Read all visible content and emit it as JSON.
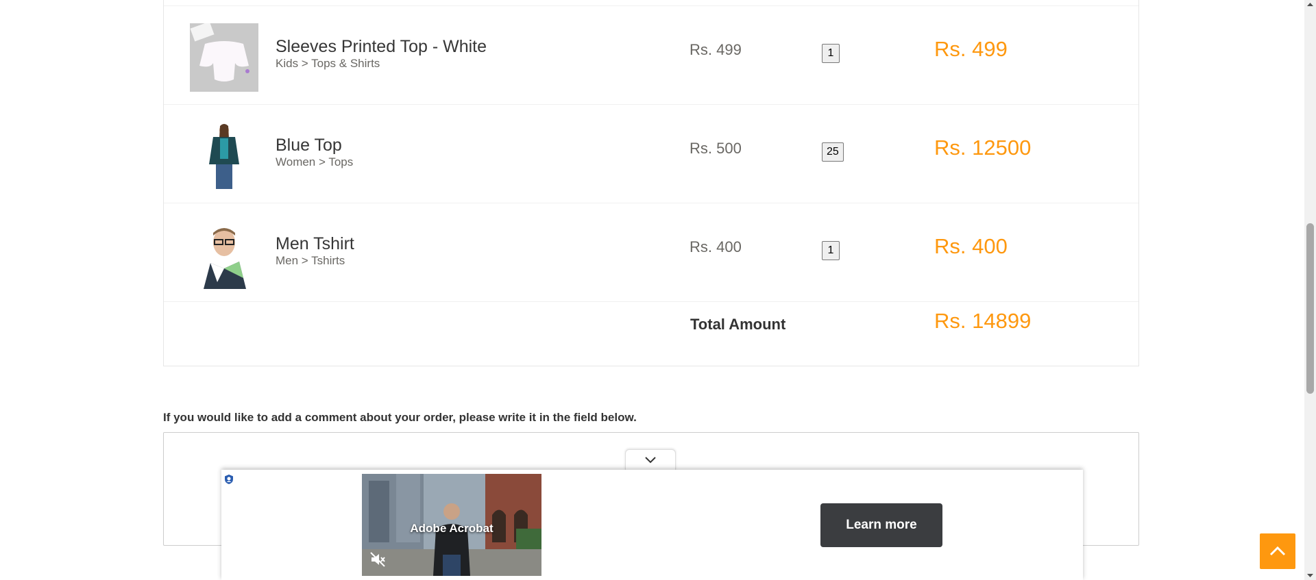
{
  "cart": {
    "items": [
      {
        "name": "Sleeves Printed Top - White",
        "category": "Kids > Tops & Shirts",
        "price": "Rs. 499",
        "quantity": "1",
        "total": "Rs. 499"
      },
      {
        "name": "Blue Top",
        "category": "Women > Tops",
        "price": "Rs. 500",
        "quantity": "25",
        "total": "Rs. 12500"
      },
      {
        "name": "Men Tshirt",
        "category": "Men > Tshirts",
        "price": "Rs. 400",
        "quantity": "1",
        "total": "Rs. 400"
      }
    ],
    "total_label": "Total Amount",
    "total_amount": "Rs. 14899"
  },
  "comment": {
    "label": "If you would like to add a comment about your order, please write it in the field below.",
    "value": ""
  },
  "ad": {
    "video_title": "Adobe Acrobat",
    "cta_label": "Learn more"
  },
  "colors": {
    "accent": "#fe980f",
    "ad_button": "#3b3d40"
  }
}
